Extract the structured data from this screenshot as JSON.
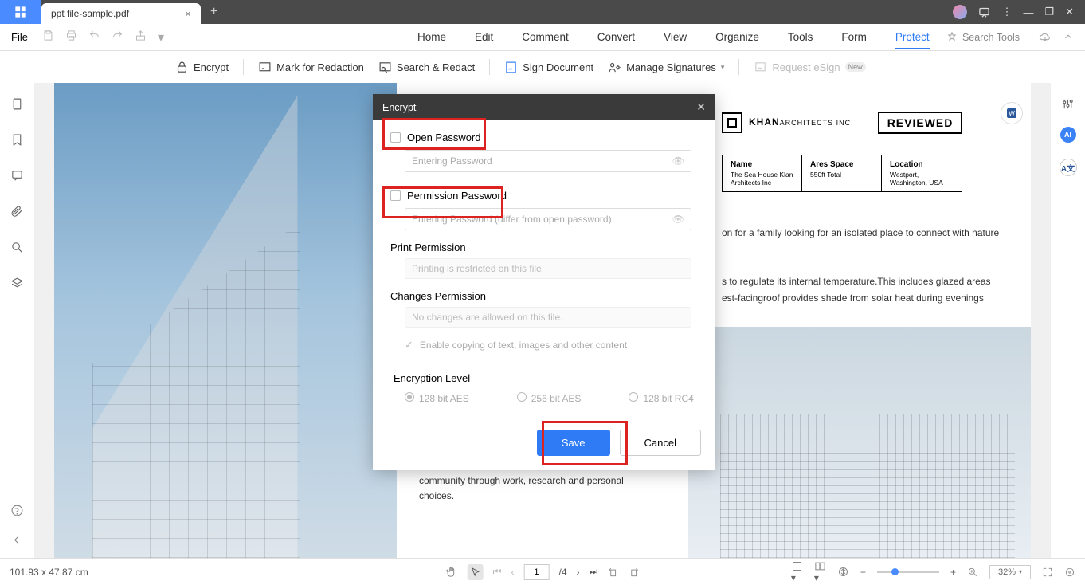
{
  "titlebar": {
    "tab_name": "ppt file-sample.pdf"
  },
  "menubar": {
    "file": "File",
    "items": [
      "Home",
      "Edit",
      "Comment",
      "Convert",
      "View",
      "Organize",
      "Tools",
      "Form",
      "Protect"
    ],
    "active_index": 8,
    "search_placeholder": "Search Tools"
  },
  "ribbon": {
    "encrypt": "Encrypt",
    "mark_redaction": "Mark for Redaction",
    "search_redact": "Search & Redact",
    "sign_document": "Sign Document",
    "manage_signatures": "Manage Signatures",
    "request_esign": "Request eSign",
    "new_badge": "New"
  },
  "dialog": {
    "title": "Encrypt",
    "open_password_label": "Open Password",
    "open_password_placeholder": "Entering Password",
    "permission_password_label": "Permission Password",
    "permission_password_placeholder": "Entering Password (differ from open password)",
    "print_permission_label": "Print Permission",
    "print_permission_value": "Printing is restricted on this file.",
    "changes_permission_label": "Changes Permission",
    "changes_permission_value": "No changes are allowed on this file.",
    "enable_copy_label": "Enable copying of text, images and other content",
    "encryption_level_label": "Encryption Level",
    "enc_options": [
      "128 bit AES",
      "256 bit AES",
      "128 bit RC4"
    ],
    "save": "Save",
    "cancel": "Cancel"
  },
  "document": {
    "khan_title": "KHAN",
    "khan_sub": "ARCHITECTS INC.",
    "reviewed": "REVIEWED",
    "info": {
      "name_h": "Name",
      "name_v1": "The Sea House Klan",
      "name_v2": "Architects Inc",
      "ares_h": "Ares Space",
      "ares_v": "550ft Total",
      "loc_h": "Location",
      "loc_v1": "Westport,",
      "loc_v2": "Washington, USA"
    },
    "para1": "on for a family looking for an isolated place to connect with nature",
    "para2a": "s to regulate its internal temperature.This includes glazed areas",
    "para2b": "est-facingroof provides shade from solar heat during evenings",
    "para3a": "community through work, research and personal",
    "para3b": "choices."
  },
  "status": {
    "dimensions": "101.93 x 47.87 cm",
    "page_current": "1",
    "page_total": "/4",
    "zoom": "32%"
  }
}
